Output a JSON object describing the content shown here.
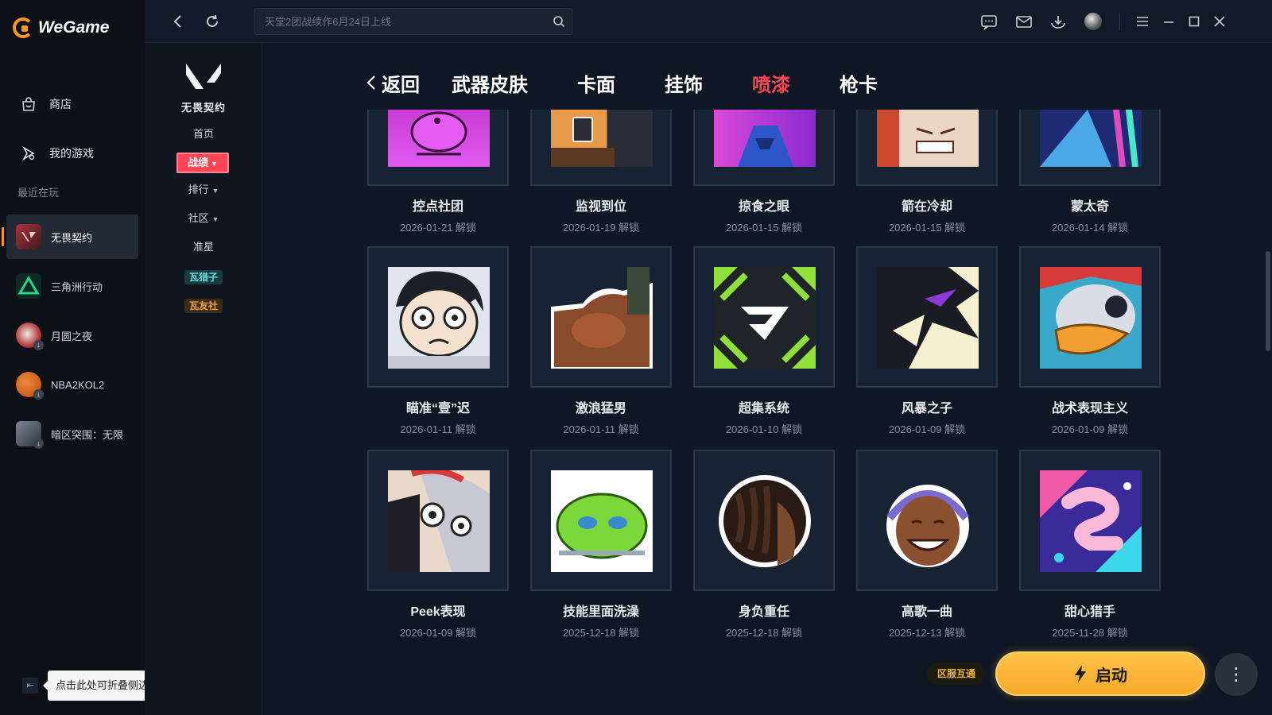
{
  "app": {
    "name": "WeGame"
  },
  "sidebar": {
    "nav": [
      {
        "label": "商店",
        "icon": "shop-bag-icon"
      },
      {
        "label": "我的游戏",
        "icon": "gamepad-icon"
      }
    ],
    "recent_label": "最近在玩",
    "recent": [
      {
        "label": "无畏契约",
        "active": true
      },
      {
        "label": "三角洲行动",
        "active": false
      },
      {
        "label": "月圆之夜",
        "active": false
      },
      {
        "label": "NBA2KOL2",
        "active": false
      },
      {
        "label": "暗区突围：无限",
        "active": false
      }
    ],
    "collapse_tooltip": "点击此处可折叠侧边栏"
  },
  "topbar": {
    "search_placeholder": "天堂2团战续作6月24日上线"
  },
  "game_nav": {
    "game_name": "无畏契约",
    "home": "首页",
    "record": "战绩",
    "rank": "排行",
    "community": "社区",
    "crosshair": "准星",
    "tag1": "瓦猎子",
    "tag2": "瓦友社"
  },
  "main": {
    "back_label": "返回",
    "tabs": [
      {
        "label": "武器皮肤",
        "active": false
      },
      {
        "label": "卡面",
        "active": false
      },
      {
        "label": "挂饰",
        "active": false
      },
      {
        "label": "喷漆",
        "active": true
      },
      {
        "label": "枪卡",
        "active": false
      }
    ],
    "unlock_suffix": "解锁",
    "sprays_row1": [
      {
        "name": "控点社团",
        "date": "2026-01-21 解锁"
      },
      {
        "name": "监视到位",
        "date": "2026-01-19 解锁"
      },
      {
        "name": "掠食之眼",
        "date": "2026-01-15 解锁"
      },
      {
        "name": "箭在冷却",
        "date": "2026-01-15 解锁"
      },
      {
        "name": "蒙太奇",
        "date": "2026-01-14 解锁"
      }
    ],
    "sprays_row2": [
      {
        "name": "瞄准“壹”迟",
        "date": "2026-01-11 解锁"
      },
      {
        "name": "激浪猛男",
        "date": "2026-01-11 解锁"
      },
      {
        "name": "超集系统",
        "date": "2026-01-10 解锁"
      },
      {
        "name": "风暴之子",
        "date": "2026-01-09 解锁"
      },
      {
        "name": "战术表现主义",
        "date": "2026-01-09 解锁"
      }
    ],
    "sprays_row3": [
      {
        "name": "Peek表现",
        "date": "2026-01-09 解锁"
      },
      {
        "name": "技能里面洗澡",
        "date": "2025-12-18 解锁"
      },
      {
        "name": "身负重任",
        "date": "2025-12-18 解锁"
      },
      {
        "name": "高歌一曲",
        "date": "2025-12-13 解锁"
      },
      {
        "name": "甜心猎手",
        "date": "2025-11-28 解锁"
      }
    ]
  },
  "launch": {
    "region_tag": "区服互通",
    "label": "启动"
  },
  "colors": {
    "accent_red": "#ff4655",
    "launch_orange": "#f7a928",
    "brand_orange": "#ff9a1f"
  }
}
